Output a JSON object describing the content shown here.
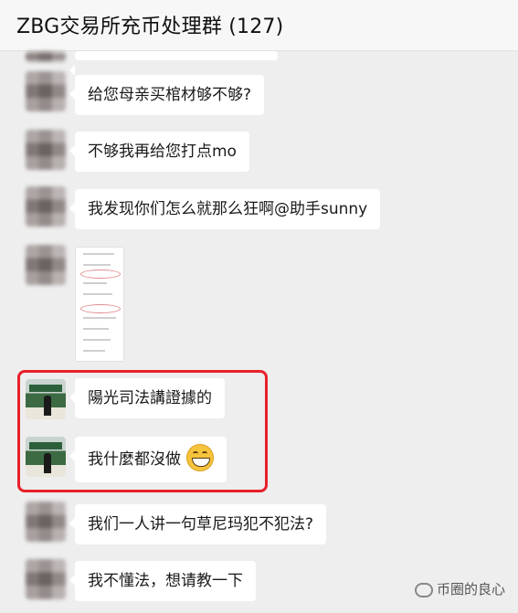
{
  "header": {
    "title": "ZBG交易所充币处理群 (127)"
  },
  "messages": [
    {
      "text": "给您母亲买棺材够不够?"
    },
    {
      "text": "不够我再给您打点mo"
    },
    {
      "text": "我发现你们怎么就那么狂啊@助手sunny"
    },
    {
      "text": "陽光司法講證據的"
    },
    {
      "text": "我什麼都沒做"
    },
    {
      "text": "我们一人讲一句草尼玛犯不犯法?"
    },
    {
      "text": "我不懂法，想请教一下"
    }
  ],
  "watermark": {
    "text": "币圈的良心"
  },
  "icons": [
    "blurred-avatar",
    "stage-avatar",
    "grin-emoji-icon",
    "wechat-icon"
  ]
}
